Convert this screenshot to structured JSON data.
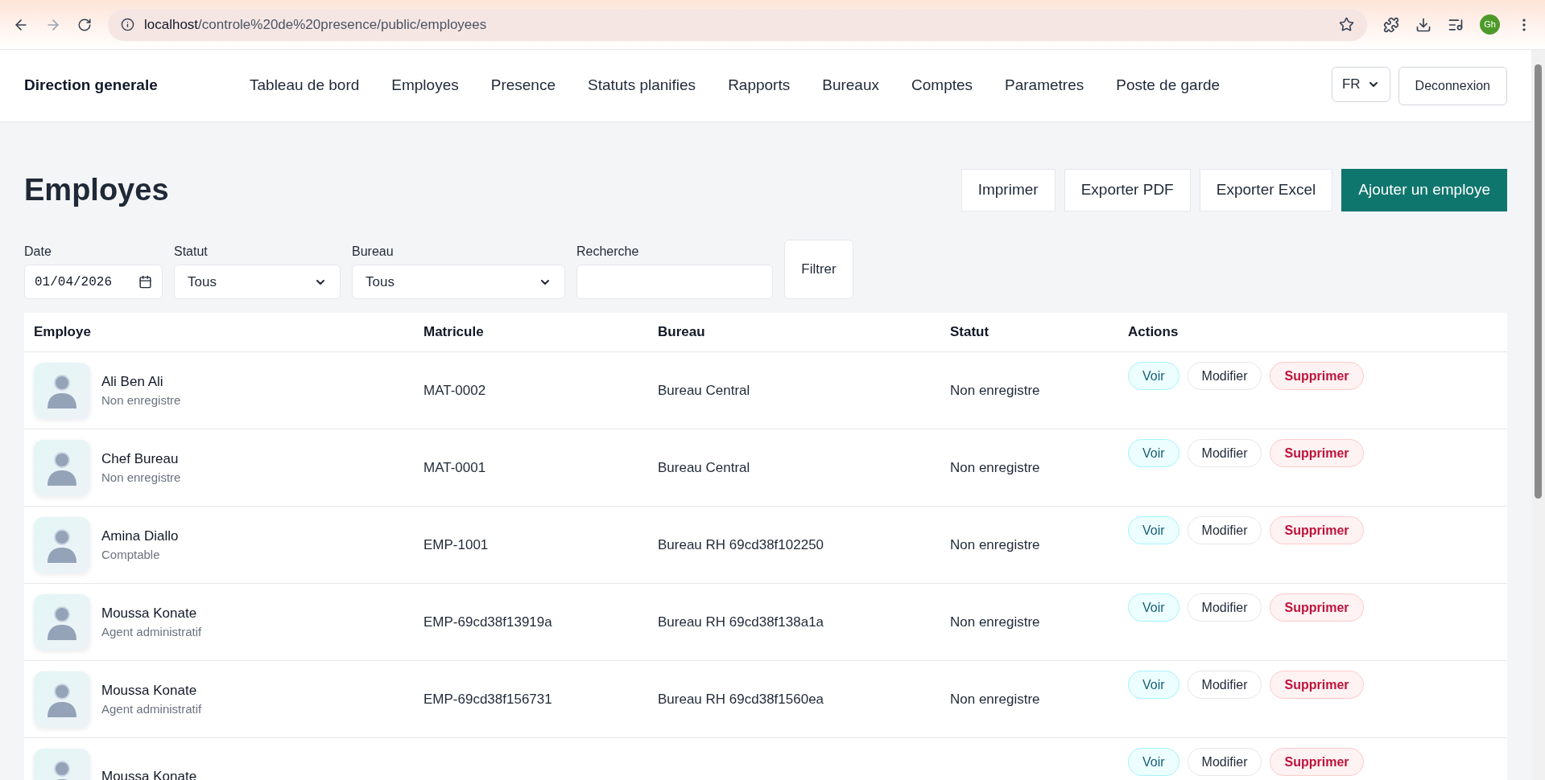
{
  "browser": {
    "url_host": "localhost",
    "url_path": "/controle%20de%20presence/public/employees",
    "profile": "Gh"
  },
  "nav": {
    "brand": "Direction generale",
    "links": [
      "Tableau de bord",
      "Employes",
      "Presence",
      "Statuts planifies",
      "Rapports",
      "Bureaux",
      "Comptes",
      "Parametres",
      "Poste de garde"
    ],
    "language": "FR",
    "logout": "Deconnexion"
  },
  "page": {
    "title": "Employes",
    "actions": [
      {
        "label": "Imprimer",
        "kind": "outline"
      },
      {
        "label": "Exporter PDF",
        "kind": "outline"
      },
      {
        "label": "Exporter Excel",
        "kind": "outline"
      },
      {
        "label": "Ajouter un employe",
        "kind": "primary"
      }
    ]
  },
  "filters": {
    "date": {
      "label": "Date",
      "value": "01/04/2026"
    },
    "status": {
      "label": "Statut",
      "value": "Tous"
    },
    "office": {
      "label": "Bureau",
      "value": "Tous"
    },
    "search": {
      "label": "Recherche"
    },
    "submit": "Filtrer"
  },
  "table": {
    "columns": [
      "Employe",
      "Matricule",
      "Bureau",
      "Statut",
      "Actions"
    ],
    "rows": [
      {
        "name": "Ali Ben Ali",
        "role": "Non enregistre",
        "matricule": "MAT-0002",
        "bureau": "Bureau Central",
        "statut": "Non enregistre",
        "actions": [
          "Voir",
          "Modifier",
          "Supprimer"
        ]
      },
      {
        "name": "Chef Bureau",
        "role": "Non enregistre",
        "matricule": "MAT-0001",
        "bureau": "Bureau Central",
        "statut": "Non enregistre",
        "actions": [
          "Voir",
          "Modifier",
          "Supprimer"
        ]
      },
      {
        "name": "Amina Diallo",
        "role": "Comptable",
        "matricule": "EMP-1001",
        "bureau": "Bureau RH 69cd38f102250",
        "statut": "Non enregistre",
        "actions": [
          "Voir",
          "Modifier",
          "Supprimer"
        ]
      },
      {
        "name": "Moussa Konate",
        "role": "Agent administratif",
        "matricule": "EMP-69cd38f13919a",
        "bureau": "Bureau RH 69cd38f138a1a",
        "statut": "Non enregistre",
        "actions": [
          "Voir",
          "Modifier",
          "Supprimer"
        ]
      },
      {
        "name": "Moussa Konate",
        "role": "Agent administratif",
        "matricule": "EMP-69cd38f156731",
        "bureau": "Bureau RH 69cd38f1560ea",
        "statut": "Non enregistre",
        "actions": [
          "Voir",
          "Modifier",
          "Supprimer"
        ]
      },
      {
        "name": "Moussa Konate",
        "actions": [
          "Voir",
          "Modifier",
          "Supprimer"
        ]
      }
    ]
  }
}
